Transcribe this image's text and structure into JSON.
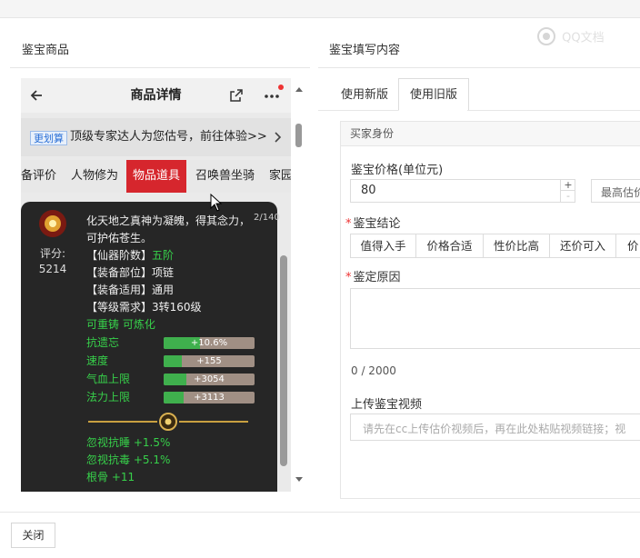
{
  "left": {
    "title": "鉴宝商品"
  },
  "right": {
    "title": "鉴宝填写内容"
  },
  "watermark": "QQ文档",
  "phone": {
    "header": {
      "title": "商品详情",
      "notification_color": "#e33"
    },
    "banner": {
      "tag": "更划算",
      "text": "顶级专家达人为您估号，前往体验>>"
    },
    "tabs": [
      "备评价",
      "人物修为",
      "物品道具",
      "召唤兽坐骑",
      "家园"
    ],
    "active_tab": "物品道具",
    "item": {
      "score_label": "评分:",
      "score_value": "5214",
      "page": "2/140",
      "desc_line1": "化天地之真神为凝魄，得其念力，",
      "desc_line2": "可护佑苍生。",
      "rank_label": "【仙器阶数】",
      "rank_value": "五阶",
      "slot": "【装备部位】项链",
      "usage": "【装备适用】通用",
      "level": "【等级需求】3转160级",
      "recast": "可重铸 可炼化",
      "attrs": [
        {
          "name": "抗遗忘",
          "value": "+10.6%",
          "fill": 0.4
        },
        {
          "name": "速度",
          "value": "+155",
          "fill": 0.2
        },
        {
          "name": "气血上限",
          "value": "+3054",
          "fill": 0.25
        },
        {
          "name": "法力上限",
          "value": "+3113",
          "fill": 0.22
        }
      ],
      "bonus1": "忽视抗睡 +1.5%",
      "bonus2": "忽视抗毒 +5.1%",
      "bonus3": "根骨 +11"
    }
  },
  "mode_tabs": {
    "new": "使用新版",
    "old": "使用旧版"
  },
  "form": {
    "section": "买家身份",
    "price_label": "鉴宝价格(单位元)",
    "price_value": "80",
    "max_label": "最高估价",
    "conclusion_label": "鉴宝结论",
    "conclusions": [
      "值得入手",
      "价格合适",
      "性价比高",
      "还价可入",
      "价"
    ],
    "reason_label": "鉴定原因",
    "counter": "0 / 2000",
    "video_label": "上传鉴宝视频",
    "video_placeholder": "请先在cc上传估价视频后，再在此处粘贴视频链接；视"
  },
  "footer": {
    "close": "关闭"
  }
}
